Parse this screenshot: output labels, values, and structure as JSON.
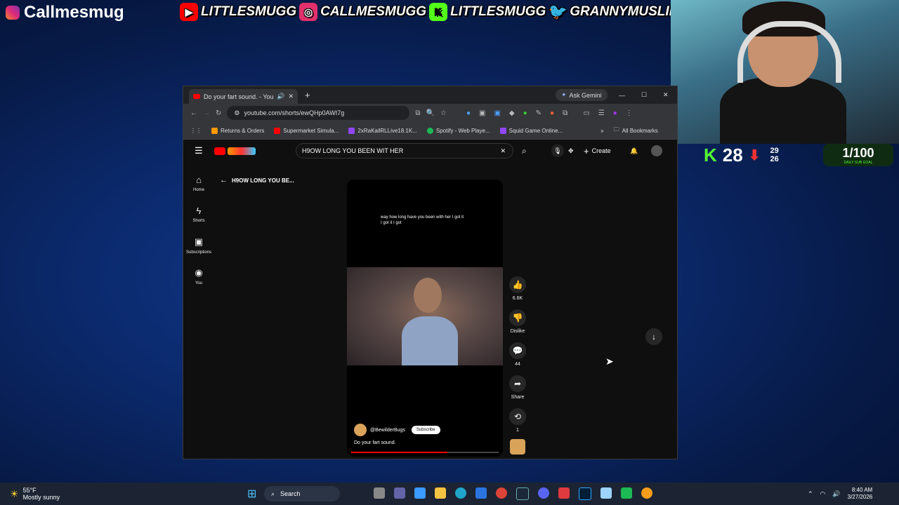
{
  "overlay": {
    "channel_name": "Callmesmug",
    "socials": [
      {
        "icon": "youtube-icon",
        "handle": "LITTLESMUGG",
        "color": "#ff0000"
      },
      {
        "icon": "instagram-icon",
        "handle": "CALLMESMUGG",
        "color": "#e1306c"
      },
      {
        "icon": "kick-icon",
        "handle": "LITTLESMUGG",
        "color": "#53fc18"
      },
      {
        "icon": "twitter-icon",
        "handle": "GRANNYMUSLIM",
        "color": "#1da1f2"
      }
    ],
    "viewer_count": "28",
    "stat_top": "29",
    "stat_bottom": "26",
    "sub_goal": "1/100",
    "sub_goal_label": "DAILY SUB GOAL"
  },
  "browser": {
    "tab_title": "Do your fart sound. - YouTu",
    "ask_gemini": "Ask Gemini",
    "url": "youtube.com/shorts/ewQHp0AWI7g",
    "bookmarks": [
      {
        "label": "Returns & Orders",
        "color": "#ff9900"
      },
      {
        "label": "Supermarket Simula...",
        "color": "#ff0000"
      },
      {
        "label": "2xRaKailRLLive18.1K...",
        "color": "#9146ff"
      },
      {
        "label": "Spotify - Web Playe...",
        "color": "#1db954"
      },
      {
        "label": "Squid Game Online...",
        "color": "#9146ff"
      }
    ],
    "all_bookmarks": "All Bookmarks"
  },
  "youtube": {
    "search_value": "H9OW LONG YOU BEEN WIT HER",
    "create_label": "Create",
    "back_title": "H9OW LONG YOU BE...",
    "nav": [
      {
        "icon": "home-icon",
        "label": "Home"
      },
      {
        "icon": "shorts-icon",
        "label": "Shorts"
      },
      {
        "icon": "subscriptions-icon",
        "label": "Subscriptions"
      },
      {
        "icon": "you-icon",
        "label": "You"
      }
    ],
    "caption": "way how long have you been with her I got it I got it I got",
    "channel_handle": "@BewilderBugs",
    "subscribe_label": "Subscribe",
    "video_title": "Do your fart sound.",
    "likes": "6.6K",
    "dislike_label": "Dislike",
    "comments": "44",
    "share_label": "Share",
    "remix_count": "1",
    "progress": 0.65
  },
  "taskbar": {
    "weather_temp": "55°F",
    "weather_desc": "Mostly sunny",
    "search_placeholder": "Search",
    "time": "8:40 AM",
    "date": "3/27/2026"
  }
}
